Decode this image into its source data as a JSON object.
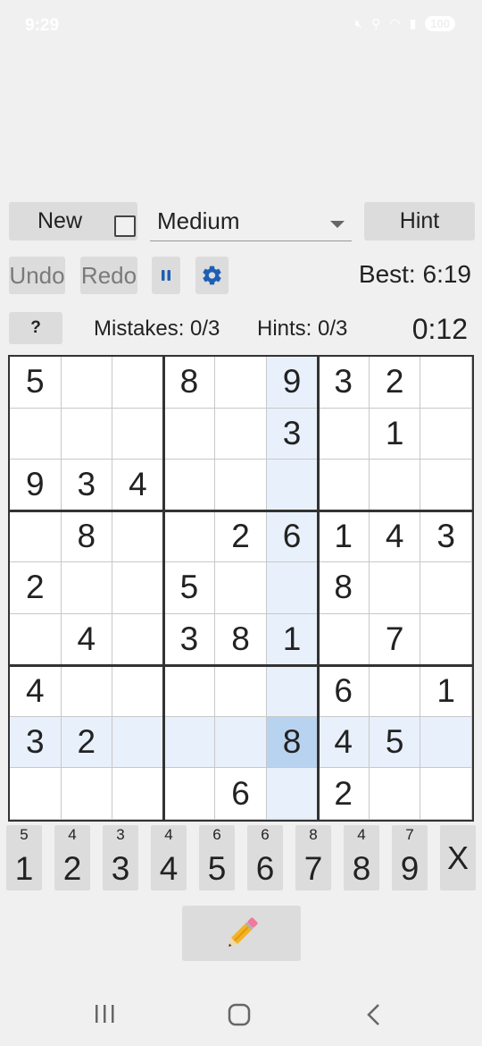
{
  "status_bar": {
    "time": "9:29",
    "battery": "100"
  },
  "toolbar": {
    "new_label": "New",
    "new_checkbox_checked": false,
    "difficulty": "Medium",
    "hint_label": "Hint",
    "undo_label": "Undo",
    "redo_label": "Redo",
    "pause_icon": "pause-icon",
    "settings_icon": "gear-icon",
    "best_time": "Best: 6:19"
  },
  "info_bar": {
    "help_label": "?",
    "mistakes": "Mistakes: 0/3",
    "hints": "Hints: 0/3",
    "timer": "0:12"
  },
  "board": {
    "selected_cell": {
      "row": 7,
      "col": 5
    },
    "rows": [
      [
        "5",
        "",
        "",
        "8",
        "",
        "9",
        "3",
        "2",
        ""
      ],
      [
        "",
        "",
        "",
        "",
        "",
        "3",
        "",
        "1",
        ""
      ],
      [
        "9",
        "3",
        "4",
        "",
        "",
        "",
        "",
        "",
        ""
      ],
      [
        "",
        "8",
        "",
        "",
        "2",
        "6",
        "1",
        "4",
        "3"
      ],
      [
        "2",
        "",
        "",
        "5",
        "",
        "",
        "8",
        "",
        ""
      ],
      [
        "",
        "4",
        "",
        "3",
        "8",
        "1",
        "",
        "7",
        ""
      ],
      [
        "4",
        "",
        "",
        "",
        "",
        "",
        "6",
        "",
        "1"
      ],
      [
        "3",
        "2",
        "",
        "",
        "",
        "8",
        "4",
        "5",
        ""
      ],
      [
        "",
        "",
        "",
        "",
        "6",
        "",
        "2",
        "",
        ""
      ]
    ]
  },
  "number_pad": {
    "keys": [
      {
        "digit": "1",
        "remaining": "5"
      },
      {
        "digit": "2",
        "remaining": "4"
      },
      {
        "digit": "3",
        "remaining": "3"
      },
      {
        "digit": "4",
        "remaining": "4"
      },
      {
        "digit": "5",
        "remaining": "6"
      },
      {
        "digit": "6",
        "remaining": "6"
      },
      {
        "digit": "7",
        "remaining": "8"
      },
      {
        "digit": "8",
        "remaining": "4"
      },
      {
        "digit": "9",
        "remaining": "7"
      }
    ],
    "erase_label": "X"
  },
  "pencil": {
    "icon": "pencil-icon"
  },
  "nav_bar": {
    "recents_icon": "recents-icon",
    "home_icon": "home-icon",
    "back_icon": "back-icon"
  },
  "colors": {
    "highlight": "#e8f0fb",
    "selected": "#b8d3ef",
    "accent": "#1e5fb4"
  }
}
